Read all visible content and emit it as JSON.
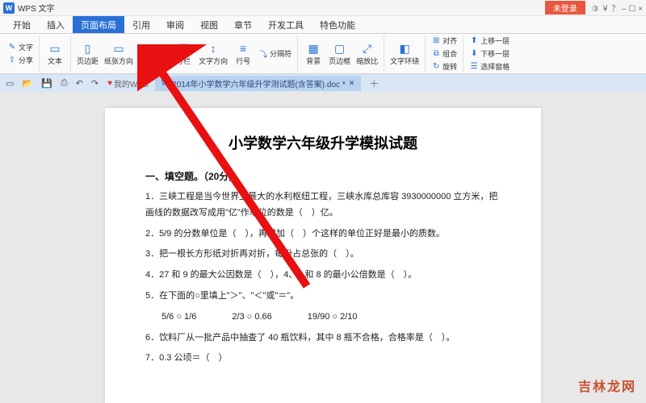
{
  "app": {
    "title": "WPS 文字"
  },
  "login_label": "未登录",
  "win_icons": "③ ￥ ？ – ☐ ×",
  "menu": [
    "开始",
    "插入",
    "页面布局",
    "引用",
    "审阅",
    "视图",
    "章节",
    "开发工具",
    "特色功能"
  ],
  "menu_active_index": 2,
  "ribbon": {
    "g1a": "文字",
    "g1b": "分享",
    "g2": "文本",
    "g3a": "页边距",
    "g3b": "纸张方向",
    "g3c": "纸张大小",
    "g3d": "分栏",
    "g3e": "文字方向",
    "g3f": "行号",
    "side1": "分隔符",
    "g4a": "背景",
    "g4b": "页边框",
    "g4c": "缩放比",
    "g5a": "文字环绕",
    "g6a": "对齐",
    "g6b": "组合",
    "g6c": "旋转",
    "g7a": "上移一层",
    "g7b": "下移一层",
    "g7c": "选择窗格"
  },
  "tab": {
    "fav": "我的WPS",
    "doc": "2014年小学数学六年级升学测试题(含答案).doc *"
  },
  "document": {
    "title": "小学数学六年级升学模拟试题",
    "section": "一、填空题。（20分）",
    "q1": "1．三峡工程是当今世界上最大的水利枢纽工程，三峡水库总库容 3930000000 立方米，把画线的数据改写成用\"亿\"作单位的数是（　）亿。",
    "q2": "2．5/9 的分数单位是（　），再增加（　）个这样的单位正好是最小的质数。",
    "q3": "3．把一根长方形纸对折再对折，每份占总张的（　）。",
    "q4": "4．27 和 9 的最大公因数是（　），4、6 和 8 的最小公倍数是（　）。",
    "q5": "5．在下面的○里填上\"＞\"、\"＜\"或\"＝\"。",
    "q5row": "5/6 ○ 1/6　　　　2/3 ○ 0.66　　　　19/90 ○ 2/10",
    "q6": "6．饮料厂从一批产品中抽查了 40 瓶饮料，其中 8 瓶不合格，合格率是（　）。",
    "q7": "7．0.3 公顷＝（　）"
  },
  "watermark": "吉林龙网"
}
